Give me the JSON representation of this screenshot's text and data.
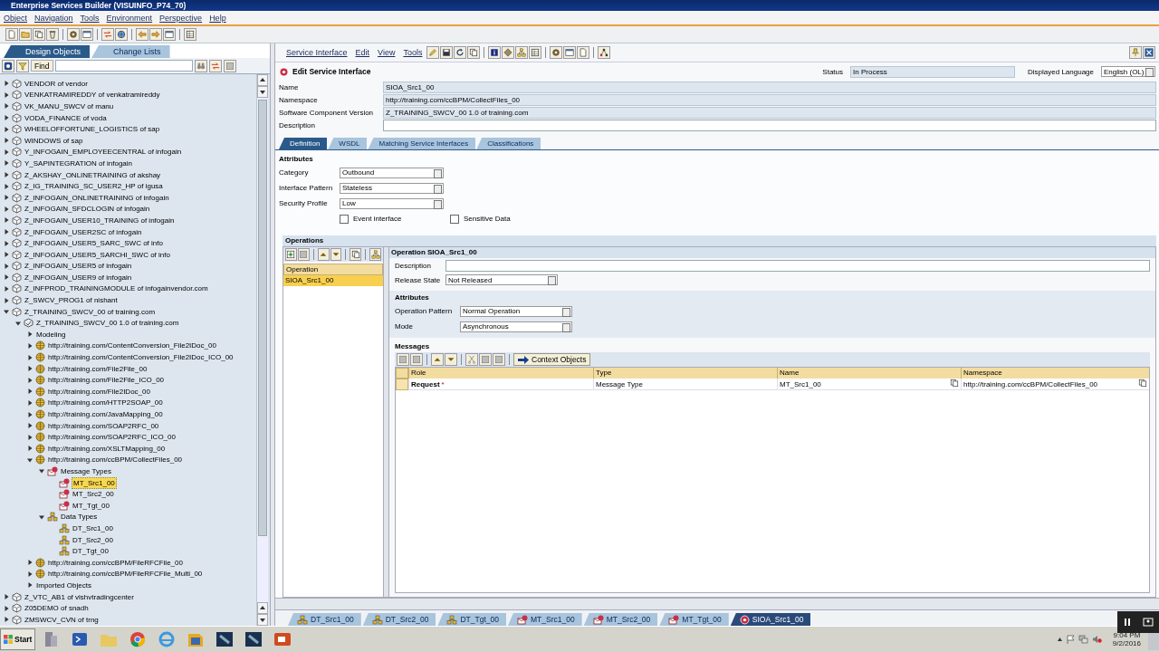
{
  "window": {
    "title": "Enterprise Services Builder (VISUINFO_P74_70)"
  },
  "menu": [
    "Object",
    "Navigation",
    "Tools",
    "Environment",
    "Perspective",
    "Help"
  ],
  "navigator_tabs": [
    {
      "label": "Design Objects",
      "selected": true
    },
    {
      "label": "Change Lists",
      "selected": false
    }
  ],
  "find": {
    "label": "Find"
  },
  "tree": [
    {
      "kind": "component",
      "label": "VENDOR of vendor",
      "expanded": false,
      "selected": false
    },
    {
      "kind": "component",
      "label": "VENKATRAMIREDDY of venkatramireddy",
      "expanded": false,
      "selected": false
    },
    {
      "kind": "component",
      "label": "VK_MANU_SWCV of manu",
      "expanded": false,
      "selected": false
    },
    {
      "kind": "component",
      "label": "VODA_FINANCE of voda",
      "expanded": false,
      "selected": false
    },
    {
      "kind": "component",
      "label": "WHEELOFFORTUNE_LOGISTICS of sap",
      "expanded": false,
      "selected": false
    },
    {
      "kind": "component",
      "label": "WINDOWS of sap",
      "expanded": false,
      "selected": false
    },
    {
      "kind": "component",
      "label": "Y_INFOGAIN_EMPLOYEECENTRAL of infogain",
      "expanded": false,
      "selected": false
    },
    {
      "kind": "component",
      "label": "Y_SAPINTEGRATION of infogain",
      "expanded": false,
      "selected": false
    },
    {
      "kind": "component",
      "label": "Z_AKSHAY_ONLINETRAINING of akshay",
      "expanded": false,
      "selected": false
    },
    {
      "kind": "component",
      "label": "Z_IG_TRAINING_SC_USER2_HP of igusa",
      "expanded": false,
      "selected": false
    },
    {
      "kind": "component",
      "label": "Z_INFOGAIN_ONLINETRAINING of infogain",
      "expanded": false,
      "selected": false
    },
    {
      "kind": "component",
      "label": "Z_INFOGAIN_SFDCLOGIN of infogain",
      "expanded": false,
      "selected": false
    },
    {
      "kind": "component",
      "label": "Z_INFOGAIN_USER10_TRAINING of infogain",
      "expanded": false,
      "selected": false
    },
    {
      "kind": "component",
      "label": "Z_INFOGAIN_USER2SC of infogain",
      "expanded": false,
      "selected": false
    },
    {
      "kind": "component",
      "label": "Z_INFOGAIN_USER5_SARC_SWC of info",
      "expanded": false,
      "selected": false
    },
    {
      "kind": "component",
      "label": "Z_INFOGAIN_USER5_SARCHI_SWC of info",
      "expanded": false,
      "selected": false
    },
    {
      "kind": "component",
      "label": "Z_INFOGAIN_USER5 of infogain",
      "expanded": false,
      "selected": false
    },
    {
      "kind": "component",
      "label": "Z_INFOGAIN_USER9 of infogain",
      "expanded": false,
      "selected": false
    },
    {
      "kind": "component",
      "label": "Z_INFPROD_TRAININGMODULE of infogainvendor.com",
      "expanded": false,
      "selected": false
    },
    {
      "kind": "component",
      "label": "Z_SWCV_PROG1 of nishant",
      "expanded": false,
      "selected": false
    },
    {
      "kind": "component",
      "label": "Z_TRAINING_SWCV_00 of training.com",
      "expanded": true,
      "selected": false,
      "children": [
        {
          "kind": "version",
          "label": "Z_TRAINING_SWCV_00 1.0 of training.com",
          "expanded": true,
          "selected": false,
          "children": [
            {
              "kind": "group",
              "label": "Modeling",
              "expanded": false,
              "selected": false
            },
            {
              "kind": "namespace",
              "label": "http://training.com/ContentConversion_File2IDoc_00",
              "expanded": false,
              "selected": false
            },
            {
              "kind": "namespace",
              "label": "http://training.com/ContentConversion_File2IDoc_ICO_00",
              "expanded": false,
              "selected": false
            },
            {
              "kind": "namespace",
              "label": "http://training.com/File2File_00",
              "expanded": false,
              "selected": false
            },
            {
              "kind": "namespace",
              "label": "http://training.com/File2File_ICO_00",
              "expanded": false,
              "selected": false
            },
            {
              "kind": "namespace",
              "label": "http://training.com/File2IDoc_00",
              "expanded": false,
              "selected": false
            },
            {
              "kind": "namespace",
              "label": "http://training.com/HTTP2SOAP_00",
              "expanded": false,
              "selected": false
            },
            {
              "kind": "namespace",
              "label": "http://training.com/JavaMapping_00",
              "expanded": false,
              "selected": false
            },
            {
              "kind": "namespace",
              "label": "http://training.com/SOAP2RFC_00",
              "expanded": false,
              "selected": false
            },
            {
              "kind": "namespace",
              "label": "http://training.com/SOAP2RFC_ICO_00",
              "expanded": false,
              "selected": false
            },
            {
              "kind": "namespace",
              "label": "http://training.com/XSLTMapping_00",
              "expanded": false,
              "selected": false
            },
            {
              "kind": "namespace",
              "label": "http://training.com/ccBPM/CollectFiles_00",
              "expanded": true,
              "selected": false,
              "children": [
                {
                  "kind": "message_types",
                  "label": "Message Types",
                  "expanded": true,
                  "selected": false,
                  "children": [
                    {
                      "kind": "message_type",
                      "label": "MT_Src1_00",
                      "selected": true
                    },
                    {
                      "kind": "message_type",
                      "label": "MT_Src2_00",
                      "selected": false
                    },
                    {
                      "kind": "message_type",
                      "label": "MT_Tgt_00",
                      "selected": false
                    }
                  ]
                },
                {
                  "kind": "data_types",
                  "label": "Data Types",
                  "expanded": true,
                  "selected": false,
                  "children": [
                    {
                      "kind": "data_type",
                      "label": "DT_Src1_00",
                      "selected": false
                    },
                    {
                      "kind": "data_type",
                      "label": "DT_Src2_00",
                      "selected": false
                    },
                    {
                      "kind": "data_type",
                      "label": "DT_Tgt_00",
                      "selected": false
                    }
                  ]
                }
              ]
            },
            {
              "kind": "namespace",
              "label": "http://training.com/ccBPM/FileRFCFile_00",
              "expanded": false,
              "selected": false
            },
            {
              "kind": "namespace",
              "label": "http://training.com/ccBPM/FileRFCFile_Multi_00",
              "expanded": false,
              "selected": false
            },
            {
              "kind": "group",
              "label": "Imported Objects",
              "expanded": false,
              "selected": false
            }
          ]
        }
      ]
    },
    {
      "kind": "component",
      "label": "Z_VTC_AB1 of vishvtradingcenter",
      "expanded": false,
      "selected": false
    },
    {
      "kind": "component",
      "label": "Z05DEMO of snadh",
      "expanded": false,
      "selected": false
    },
    {
      "kind": "component",
      "label": "ZMSWCV_CVN of trng",
      "expanded": false,
      "selected": false
    }
  ],
  "editor": {
    "menu": [
      "Service Interface",
      "Edit",
      "View",
      "Tools"
    ],
    "title": "Edit Service Interface",
    "status_label": "Status",
    "status": "In Process",
    "language_label": "Displayed Language",
    "language": "English (OL)",
    "fields": [
      {
        "label": "Name",
        "value": "SIOA_Src1_00",
        "kind": "readonly"
      },
      {
        "label": "Namespace",
        "value": "http://training.com/ccBPM/CollectFiles_00",
        "kind": "readonly"
      },
      {
        "label": "Software Component Version",
        "value": "Z_TRAINING_SWCV_00 1.0 of training.com",
        "kind": "readonly"
      },
      {
        "label": "Description",
        "kind": "editable"
      }
    ],
    "tabs": [
      {
        "label": "Definition",
        "selected": true
      },
      {
        "label": "WSDL",
        "selected": false
      },
      {
        "label": "Matching Service Interfaces",
        "selected": false
      },
      {
        "label": "Classifications",
        "selected": false
      }
    ],
    "attributes": {
      "title": "Attributes",
      "fields": [
        {
          "label": "Category",
          "value": "Outbound"
        },
        {
          "label": "Interface Pattern",
          "value": "Stateless"
        },
        {
          "label": "Security Profile",
          "value": "Low"
        }
      ],
      "checkboxes": [
        {
          "label": "Event interface",
          "checked": false
        },
        {
          "label": "Sensitive Data",
          "checked": false
        }
      ]
    },
    "operations": {
      "title": "Operations",
      "list_header": "Operation",
      "items": [
        {
          "label": "SIOA_Src1_00",
          "selected": true
        }
      ],
      "detail": {
        "title": "Operation SIOA_Src1_00",
        "description_label": "Description",
        "release_label": "Release State",
        "release": "Not Released",
        "attributes_title": "Attributes",
        "attributes": [
          {
            "label": "Operation Pattern",
            "value": "Normal Operation"
          },
          {
            "label": "Mode",
            "value": "Asynchronous"
          }
        ],
        "messages_title": "Messages",
        "context_button": "Context Objects",
        "columns": [
          "Role",
          "Type",
          "Name",
          "Namespace"
        ],
        "rows": [
          {
            "role": "Request",
            "required_mark": "*",
            "type": "Message Type",
            "name": "MT_Src1_00",
            "namespace": "http://training.com/ccBPM/CollectFiles_00"
          }
        ]
      }
    }
  },
  "editor_tabs": [
    {
      "label": "DT_Src1_00",
      "kind": "data_type",
      "selected": false
    },
    {
      "label": "DT_Src2_00",
      "kind": "data_type",
      "selected": false
    },
    {
      "label": "DT_Tgt_00",
      "kind": "data_type",
      "selected": false
    },
    {
      "label": "MT_Src1_00",
      "kind": "message_type",
      "selected": false
    },
    {
      "label": "MT_Src2_00",
      "kind": "message_type",
      "selected": false
    },
    {
      "label": "MT_Tgt_00",
      "kind": "message_type",
      "selected": false
    },
    {
      "label": "SIOA_Src1_00",
      "kind": "service_interface",
      "selected": true
    }
  ],
  "taskbar": {
    "start": "Start",
    "time": "9:04 PM",
    "date": "9/2/2016"
  }
}
